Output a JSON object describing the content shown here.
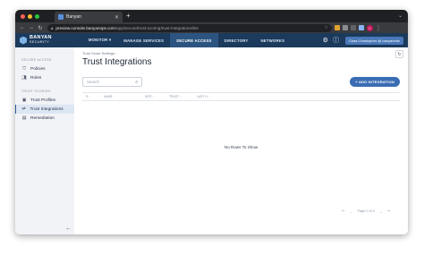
{
  "browser": {
    "tab_title": "Banyan",
    "url_host": "preview.console.banyanops.com",
    "url_path": "/app/secure/trust-scoring/trust-integrations/list",
    "profile_initial": "C",
    "colors": {
      "traffic_red": "#ff5f57",
      "traffic_yellow": "#febc2e",
      "traffic_green": "#28c840"
    }
  },
  "header": {
    "logo_line1": "BANYAN",
    "logo_line2": "SECURITY",
    "nav": [
      {
        "label": "MONITOR ▾"
      },
      {
        "label": "MANAGE SERVICES"
      },
      {
        "label": "SECURE ACCESS"
      },
      {
        "label": "DIRECTORY"
      },
      {
        "label": "NETWORKS"
      }
    ],
    "user_label": "Clara Christopher @ banyanmfz"
  },
  "sidebar": {
    "section1": "SECURE ACCESS",
    "items1": [
      {
        "label": "Policies",
        "icon": "shield-icon"
      },
      {
        "label": "Roles",
        "icon": "users-icon"
      }
    ],
    "section2": "TRUST SCORING",
    "items2": [
      {
        "label": "Trust Profiles",
        "icon": "profile-icon"
      },
      {
        "label": "Trust Integrations",
        "icon": "link-icon"
      },
      {
        "label": "Remediation",
        "icon": "document-icon"
      }
    ]
  },
  "main": {
    "breadcrumb": "Trust Score Settings ›",
    "title": "Trust Integrations",
    "search_placeholder": "Search",
    "add_button": "+ ADD INTEGRATION",
    "columns": [
      "S...",
      "NAME",
      "INTE...",
      "TRUST ...",
      "LAST U..."
    ],
    "empty_text": "No Rows To Show",
    "pager_text": "Page 0 of 0"
  }
}
